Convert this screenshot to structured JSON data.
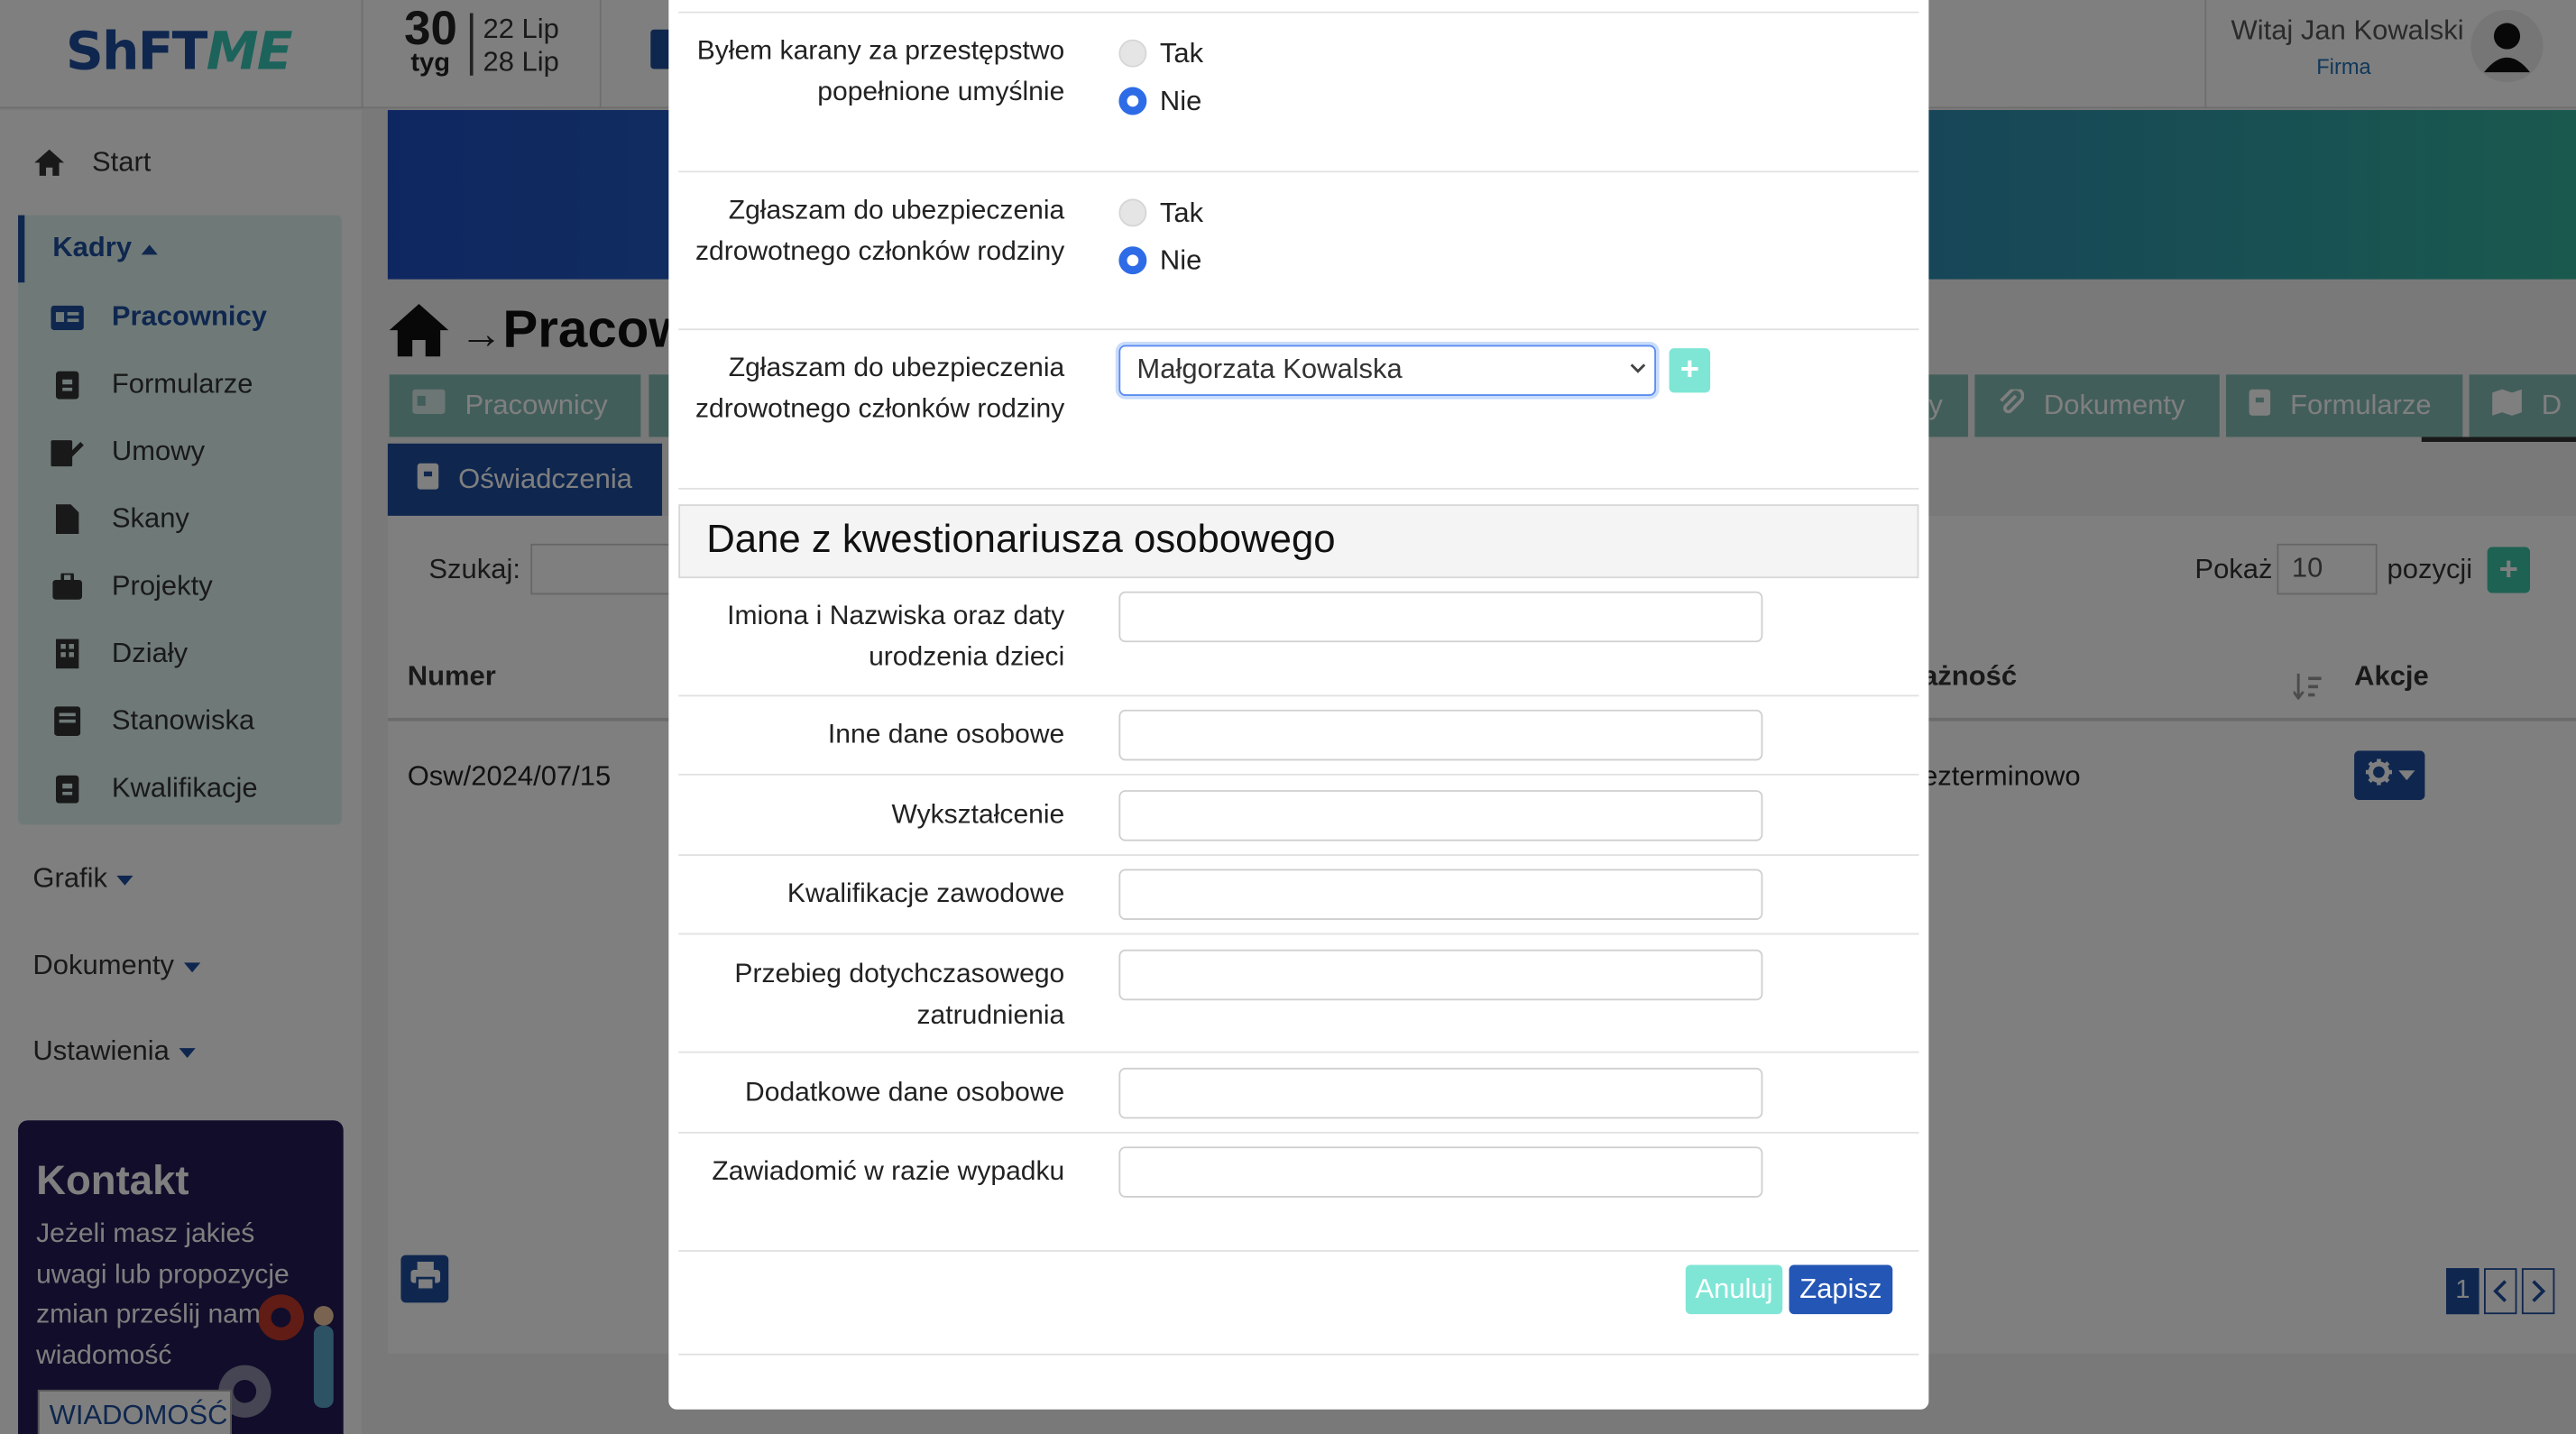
{
  "header": {
    "logo_main": "ShFT",
    "logo_accent": "ME",
    "week_number": "30",
    "week_label": "tyg",
    "week_start": "22 Lip",
    "week_end": "28 Lip",
    "greeting": "Witaj Jan Kowalski",
    "company": "Firma"
  },
  "sidebar": {
    "start": "Start",
    "kadry": "Kadry",
    "kadry_items": [
      {
        "label": "Pracownicy",
        "icon": "id-card-icon"
      },
      {
        "label": "Formularze",
        "icon": "clipboard-icon"
      },
      {
        "label": "Umowy",
        "icon": "signature-icon"
      },
      {
        "label": "Skany",
        "icon": "file-icon"
      },
      {
        "label": "Projekty",
        "icon": "briefcase-icon"
      },
      {
        "label": "Działy",
        "icon": "building-icon"
      },
      {
        "label": "Stanowiska",
        "icon": "book-icon"
      },
      {
        "label": "Kwalifikacje",
        "icon": "clipboard-icon"
      }
    ],
    "grafik": "Grafik",
    "dokumenty": "Dokumenty",
    "ustawienia": "Ustawienia",
    "contact": {
      "title": "Kontakt",
      "text": "Jeżeli masz jakieś uwagi lub propozycje zmian prześlij nam wiadomość",
      "button": "WIADOMOŚĆ"
    }
  },
  "page": {
    "breadcrumb_title": "Pracownicy",
    "tabs": [
      {
        "label": "Pracownicy",
        "icon": "id-card-icon"
      },
      {
        "label": "y",
        "icon": ""
      },
      {
        "label": "Dokumenty",
        "icon": "paperclip-icon"
      },
      {
        "label": "Formularze",
        "icon": "clipboard-icon"
      },
      {
        "label": "D",
        "icon": "map-icon"
      }
    ],
    "active_tab": "Oświadczenia",
    "search_label": "Szukaj:",
    "show_label": "Pokaż",
    "show_value": "10",
    "positions_label": "pozycji",
    "columns": {
      "numer": "Numer",
      "waznosc": "ażność",
      "akcje": "Akcje"
    },
    "row": {
      "numer": "Osw/2024/07/15",
      "waznosc": "ezterminowo"
    },
    "pagination": {
      "current": "1"
    }
  },
  "modal": {
    "q1_label": "Byłem karany za przestępstwo popełnione umyślnie",
    "q2_label": "Zgłaszam do ubezpieczenia zdrowotnego członków rodziny",
    "q3_label": "Zgłaszam do ubezpieczenia zdrowotnego członków rodziny",
    "yes": "Tak",
    "no": "Nie",
    "q1_selected": "Nie",
    "q2_selected": "Nie",
    "family_member": "Małgorzata Kowalska",
    "section_title": "Dane z kwestionariusza osobowego",
    "fields": [
      {
        "label": "Imiona i Nazwiska oraz daty urodzenia dzieci",
        "value": ""
      },
      {
        "label": "Inne dane osobowe",
        "value": ""
      },
      {
        "label": "Wykształcenie",
        "value": ""
      },
      {
        "label": "Kwalifikacje zawodowe",
        "value": ""
      },
      {
        "label": "Przebieg dotychczasowego zatrudnienia",
        "value": ""
      },
      {
        "label": "Dodatkowe dane osobowe",
        "value": ""
      },
      {
        "label": "Zawiadomić w razie wypadku",
        "value": ""
      }
    ],
    "cancel": "Anuluj",
    "save": "Zapisz"
  },
  "colors": {
    "brand": "#1f4e9e",
    "accent": "#3cc5a6",
    "primary_button": "#2456b5"
  }
}
